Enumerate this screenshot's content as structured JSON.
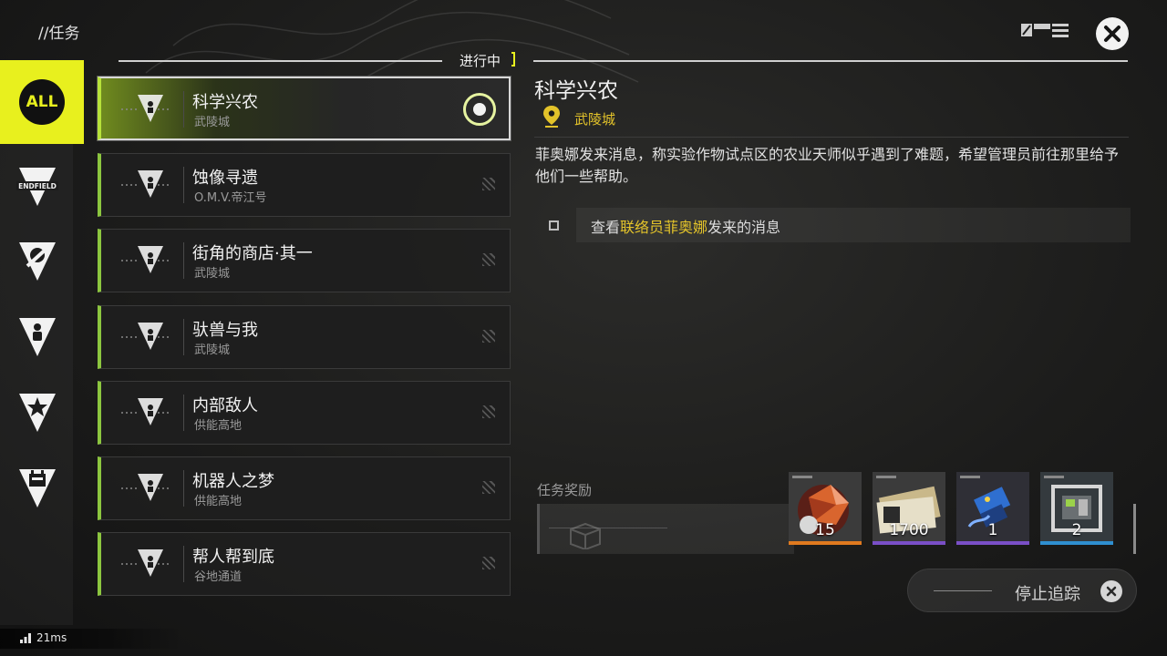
{
  "header": {
    "title": "//任务",
    "status_label": "进行中"
  },
  "colors": {
    "accent_yellow": "#e8f01e",
    "accent_green": "#8cc63f",
    "location_gold": "#e3c32a"
  },
  "categories": [
    {
      "label": "ALL",
      "icon": "all-badge-icon",
      "selected": true
    },
    {
      "label": "ENDFIELD",
      "icon": "endfield-emblem-icon",
      "selected": false
    },
    {
      "label": "",
      "icon": "slash-emblem-icon",
      "selected": false
    },
    {
      "label": "",
      "icon": "person-emblem-icon",
      "selected": false
    },
    {
      "label": "",
      "icon": "star-emblem-icon",
      "selected": false
    },
    {
      "label": "",
      "icon": "calendar-emblem-icon",
      "selected": false
    }
  ],
  "quests": [
    {
      "name": "科学兴农",
      "location": "武陵城",
      "tracked": true
    },
    {
      "name": "蚀像寻遗",
      "location": "O.M.V.帝江号",
      "tracked": false
    },
    {
      "name": "街角的商店·其一",
      "location": "武陵城",
      "tracked": false
    },
    {
      "name": "驮兽与我",
      "location": "武陵城",
      "tracked": false
    },
    {
      "name": "内部敌人",
      "location": "供能高地",
      "tracked": false
    },
    {
      "name": "机器人之梦",
      "location": "供能高地",
      "tracked": false
    },
    {
      "name": "帮人帮到底",
      "location": "谷地通道",
      "tracked": false
    }
  ],
  "detail": {
    "title": "科学兴农",
    "location": "武陵城",
    "description": "菲奥娜发来消息，称实验作物试点区的农业天师似乎遇到了难题，希望管理员前往那里给予他们一些帮助。",
    "objective": {
      "prefix": "查看",
      "highlight": "联络员菲奥娜",
      "suffix": "发来的消息"
    }
  },
  "rewards": {
    "label": "任务奖励",
    "items": [
      {
        "icon": "orange-crystal-item-icon",
        "qty": "15",
        "rarity_color": "#e07a1f"
      },
      {
        "icon": "currency-notes-item-icon",
        "qty": "1700",
        "rarity_color": "#7a4fc7"
      },
      {
        "icon": "blue-device-item-icon",
        "qty": "1",
        "rarity_color": "#7a4fc7"
      },
      {
        "icon": "machine-frame-item-icon",
        "qty": "2",
        "rarity_color": "#2f8fd0"
      }
    ]
  },
  "actions": {
    "stop_tracking": "停止追踪"
  },
  "network": {
    "ping": "21ms"
  }
}
